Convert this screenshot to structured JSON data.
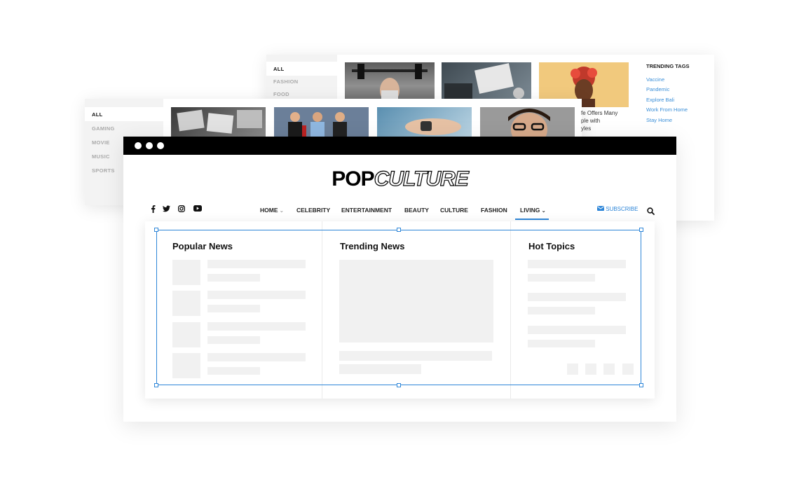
{
  "back_panel": {
    "categories": [
      "ALL",
      "FASHION",
      "FOOD"
    ],
    "trending_tags": {
      "heading": "TRENDING TAGS",
      "tags": [
        "Vaccine",
        "Pandemic",
        "Explore Bali",
        "Work From Home",
        "Stay Home"
      ]
    }
  },
  "middle_panel": {
    "categories": [
      "ALL",
      "GAMING",
      "MOVIE",
      "MUSIC",
      "SPORTS"
    ],
    "article_snippet": [
      "fe Offers Many",
      "ple with",
      "yles"
    ]
  },
  "browser": {
    "logo": {
      "bold": "POP",
      "outline": "CULTURE"
    },
    "social_icons": [
      "facebook-icon",
      "twitter-icon",
      "instagram-icon",
      "youtube-icon"
    ],
    "nav": {
      "items": [
        "HOME",
        "CELEBRITY",
        "ENTERTAINMENT",
        "BEAUTY",
        "CULTURE",
        "FASHION",
        "LIVING"
      ],
      "active": "LIVING",
      "subscribe": "SUBSCRIBE"
    },
    "sections": {
      "popular": "Popular News",
      "trending": "Trending News",
      "hot": "Hot Topics"
    }
  },
  "colors": {
    "accent": "#2e86d8",
    "titlebar": "#000000",
    "skeleton": "#f1f1f1"
  }
}
